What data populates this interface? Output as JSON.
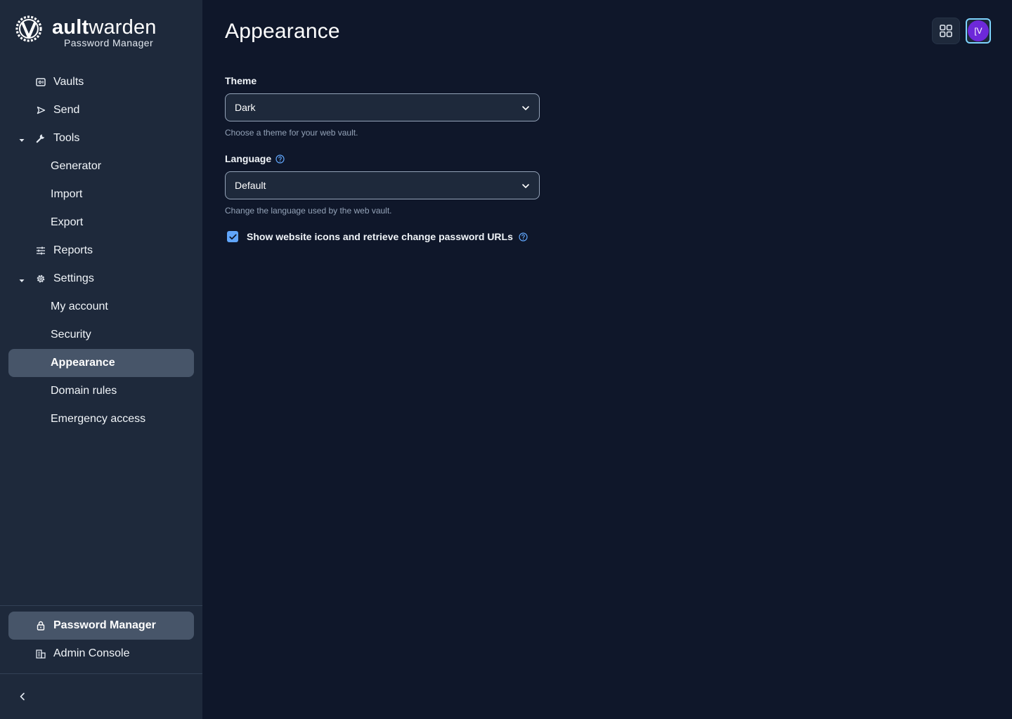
{
  "brand": {
    "name_bold": "V",
    "name_part1": "ault",
    "name_part2": "warden",
    "subtitle": "Password Manager"
  },
  "sidebar": {
    "items": [
      {
        "label": "Vaults",
        "icon": "vault-icon"
      },
      {
        "label": "Send",
        "icon": "send-icon"
      },
      {
        "label": "Tools",
        "icon": "wrench-icon",
        "expanded": true
      },
      {
        "label": "Generator"
      },
      {
        "label": "Import"
      },
      {
        "label": "Export"
      },
      {
        "label": "Reports",
        "icon": "sliders-icon"
      },
      {
        "label": "Settings",
        "icon": "gear-icon",
        "expanded": true
      },
      {
        "label": "My account"
      },
      {
        "label": "Security"
      },
      {
        "label": "Appearance",
        "active": true
      },
      {
        "label": "Domain rules"
      },
      {
        "label": "Emergency access"
      }
    ],
    "bottom_items": [
      {
        "label": "Password Manager",
        "icon": "lock-icon",
        "active": true
      },
      {
        "label": "Admin Console",
        "icon": "building-icon"
      }
    ]
  },
  "header": {
    "title": "Appearance",
    "avatar_initials": "[V"
  },
  "form": {
    "theme": {
      "label": "Theme",
      "value": "Dark",
      "hint": "Choose a theme for your web vault."
    },
    "language": {
      "label": "Language",
      "value": "Default",
      "hint": "Change the language used by the web vault."
    },
    "website_icons": {
      "label": "Show website icons and retrieve change password URLs",
      "checked": true
    }
  },
  "colors": {
    "background": "#0f172a",
    "sidebar": "#1e293b",
    "active_item": "#475569",
    "accent": "#60a5fa",
    "avatar": "#6d28d9"
  }
}
